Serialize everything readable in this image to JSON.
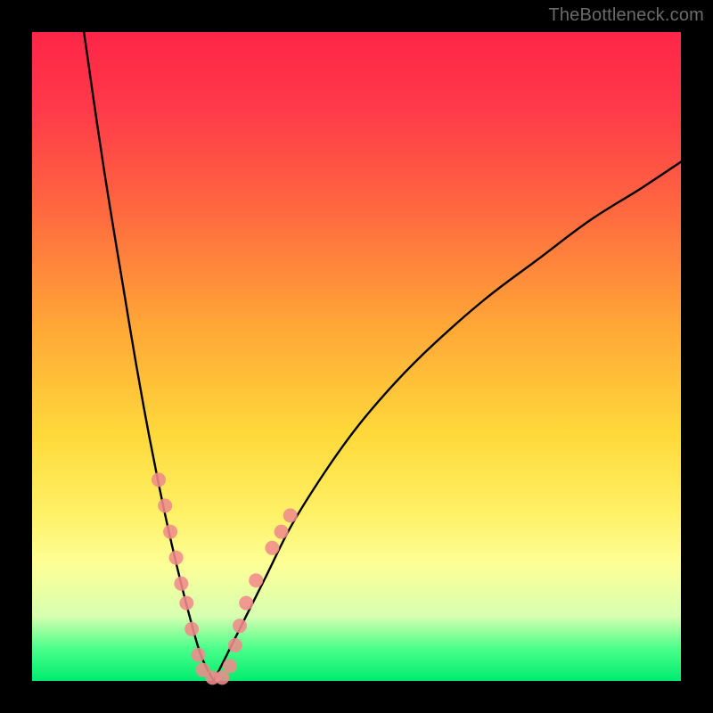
{
  "watermark": "TheBottleneck.com",
  "chart_data": {
    "type": "line",
    "title": "",
    "xlabel": "",
    "ylabel": "",
    "xlim": [
      0,
      100
    ],
    "ylim": [
      0,
      100
    ],
    "grid": false,
    "legend": false,
    "description": "V-shaped bottleneck curve over rainbow gradient. Left branch descends steeply from near x≈8,y≈100 to the trough; right branch rises with diminishing slope toward x≈100,y≈80. Trough (optimal zone) lies near x≈25–30 at y≈0. Pink dot markers cluster along both branches in the lower third (y≲30).",
    "series": [
      {
        "name": "left-branch",
        "x": [
          8,
          10,
          12,
          14,
          16,
          18,
          20,
          22,
          24,
          26,
          28
        ],
        "values": [
          100,
          86,
          73,
          61,
          49,
          38,
          28,
          19,
          11,
          4,
          0
        ]
      },
      {
        "name": "right-branch",
        "x": [
          28,
          30,
          33,
          36,
          40,
          45,
          50,
          56,
          62,
          70,
          78,
          86,
          94,
          100
        ],
        "values": [
          0,
          4,
          10,
          16,
          24,
          32,
          39,
          46,
          52,
          59,
          65,
          71,
          76,
          80
        ]
      }
    ],
    "markers": {
      "color": "#f08b8b",
      "radius": 8,
      "points": [
        {
          "x": 19.5,
          "y": 31
        },
        {
          "x": 20.5,
          "y": 27
        },
        {
          "x": 21.3,
          "y": 23
        },
        {
          "x": 22.2,
          "y": 19
        },
        {
          "x": 23.0,
          "y": 15
        },
        {
          "x": 23.8,
          "y": 12
        },
        {
          "x": 24.6,
          "y": 8
        },
        {
          "x": 25.6,
          "y": 4
        },
        {
          "x": 26.3,
          "y": 1.7
        },
        {
          "x": 27.8,
          "y": 0.5
        },
        {
          "x": 29.3,
          "y": 0.5
        },
        {
          "x": 30.5,
          "y": 2.3
        },
        {
          "x": 31.3,
          "y": 5.5
        },
        {
          "x": 32.0,
          "y": 8.5
        },
        {
          "x": 33.0,
          "y": 12
        },
        {
          "x": 34.5,
          "y": 15.5
        },
        {
          "x": 37.0,
          "y": 20.5
        },
        {
          "x": 38.4,
          "y": 23
        },
        {
          "x": 39.8,
          "y": 25.5
        }
      ]
    }
  }
}
